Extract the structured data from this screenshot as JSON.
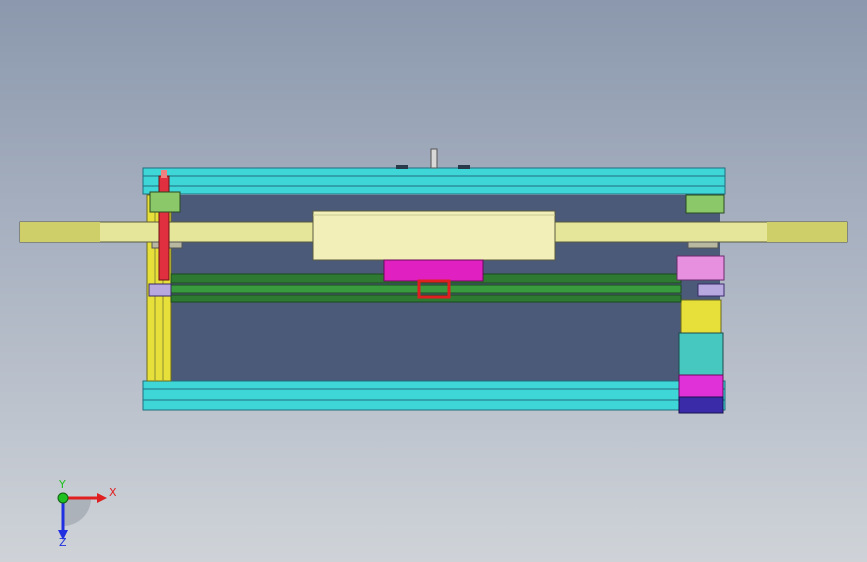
{
  "viewport": {
    "background_top": "#8b98ad",
    "background_bottom": "#cfd3d8"
  },
  "model": {
    "colors": {
      "frame_cyan": "#3fd6d8",
      "frame_dark": "#4a5a78",
      "disc_yellow": "#e6e69a",
      "post_yellow": "#e8e03a",
      "rail_green": "#2e7a32",
      "block_magenta": "#e020c0",
      "motor_teal": "#46c8c0",
      "motor_blue": "#3a2ca8",
      "nozzle_red": "#e03040"
    }
  },
  "triad": {
    "x_label": "X",
    "y_label": "Y",
    "z_label": "Z",
    "x_color": "#e02020",
    "y_color": "#20c020",
    "z_color": "#2030e0"
  }
}
